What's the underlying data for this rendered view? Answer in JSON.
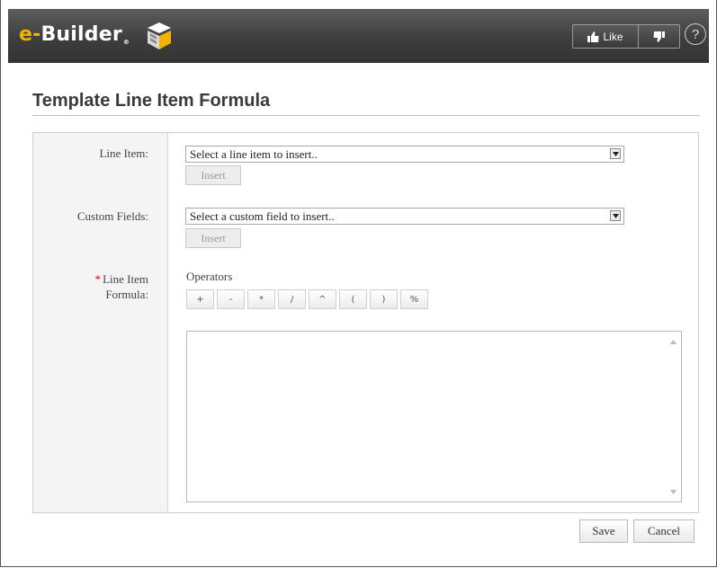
{
  "header": {
    "logo_prefix": "e-",
    "logo_text": "Builder",
    "logo_reg": "®",
    "like_label": "Like",
    "help_label": "?"
  },
  "page": {
    "title": "Template Line Item Formula"
  },
  "form": {
    "line_item": {
      "label": "Line Item:",
      "placeholder": "Select a line item to insert..",
      "insert_label": "Insert"
    },
    "custom_fields": {
      "label": "Custom Fields:",
      "placeholder": "Select a custom field to insert..",
      "insert_label": "Insert"
    },
    "formula": {
      "required_mark": "*",
      "label_line1": "Line Item",
      "label_line2": "Formula:",
      "operators_label": "Operators",
      "operators": [
        "+",
        "-",
        "*",
        "/",
        "^",
        "(",
        ")",
        "%"
      ],
      "value": ""
    }
  },
  "footer": {
    "save_label": "Save",
    "cancel_label": "Cancel"
  },
  "colors": {
    "logo_accent": "#f0b400",
    "required": "#cc0000",
    "header_bg": "#444444"
  }
}
